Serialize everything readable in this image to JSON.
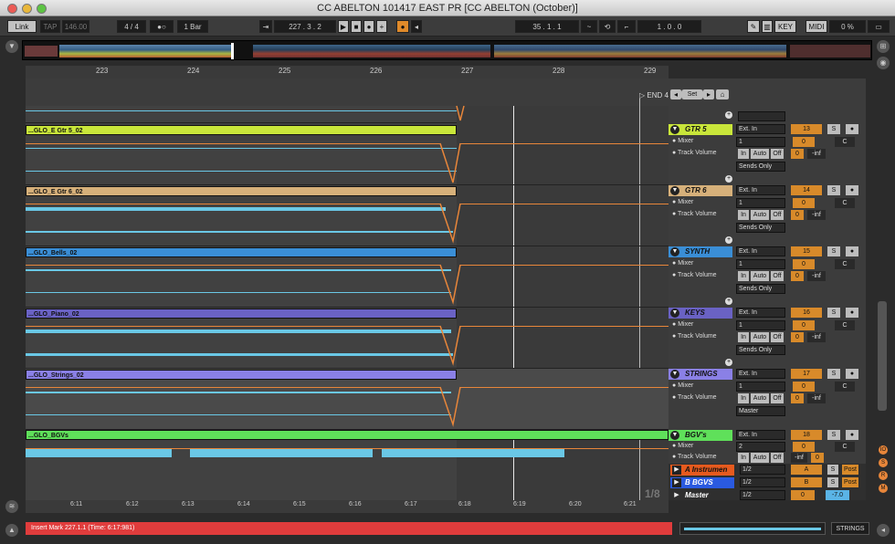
{
  "window": {
    "title": "CC ABELTON 101417 EAST PR  [CC ABELTON (October)]"
  },
  "toolbar": {
    "link": "Link",
    "tap": "TAP",
    "tempo": "146.00",
    "signature": "4 / 4",
    "quantize": "1 Bar",
    "position": "227 .  3 .  2",
    "loop_start": "35 .  1 .  1",
    "loop_length": "1 .  0 .  0",
    "key": "KEY",
    "midi": "MIDI",
    "cpu": "0 %"
  },
  "ruler": {
    "bars": [
      "223",
      "224",
      "225",
      "226",
      "227",
      "228",
      "229"
    ],
    "end_marker": "END 4"
  },
  "locators": {
    "set": "Set"
  },
  "tracks": [
    {
      "clip": "...GLO_E Gtr 5_02",
      "name": "GTR 5",
      "color": "#c9e63a",
      "input": "Ext. In",
      "monitor": "Mixer",
      "channel": "1",
      "param": "Track Volume",
      "number": "13",
      "sends": "Sends Only",
      "inf": "-inf",
      "c": "C",
      "s": "S"
    },
    {
      "clip": "...GLO_E Gtr 6_02",
      "name": "GTR 6",
      "color": "#d6b07a",
      "input": "Ext. In",
      "monitor": "Mixer",
      "channel": "1",
      "param": "Track Volume",
      "number": "14",
      "sends": "Sends Only",
      "inf": "-inf",
      "c": "C",
      "s": "S"
    },
    {
      "clip": "...GLO_Bells_02",
      "name": "SYNTH",
      "color": "#3a8ed6",
      "input": "Ext. In",
      "monitor": "Mixer",
      "channel": "1",
      "param": "Track Volume",
      "number": "15",
      "sends": "Sends Only",
      "inf": "-inf",
      "c": "C",
      "s": "S"
    },
    {
      "clip": "...GLO_Piano_02",
      "name": "KEYS",
      "color": "#6a62c4",
      "input": "Ext. In",
      "monitor": "Mixer",
      "channel": "1",
      "param": "Track Volume",
      "number": "16",
      "sends": "Sends Only",
      "inf": "-inf",
      "c": "C",
      "s": "S"
    },
    {
      "clip": "...GLO_Strings_02",
      "name": "STRINGS",
      "color": "#8a80e6",
      "input": "Ext. In",
      "monitor": "Mixer",
      "channel": "1",
      "param": "Track Volume",
      "number": "17",
      "sends": "Master",
      "inf": "-inf",
      "c": "C",
      "s": "S"
    },
    {
      "clip": "...GLO_BGVs",
      "name": "BGV's",
      "color": "#5fe05a",
      "input": "Ext. In",
      "monitor": "Mixer",
      "channel": "2",
      "param": "Track Volume",
      "number": "18",
      "sends": "",
      "inf": "-inf",
      "c": "C",
      "s": "S"
    }
  ],
  "modes": {
    "in": "In",
    "auto": "Auto",
    "off": "Off",
    "zero": "0"
  },
  "returns": [
    {
      "name": "A Instrumen",
      "color": "#e65a1e",
      "route": "1/2",
      "letter": "A",
      "post": "Post"
    },
    {
      "name": "B BGVS",
      "color": "#2a5ae0",
      "route": "1/2",
      "letter": "B",
      "post": "Post"
    },
    {
      "name": "Master",
      "color": "#3c3c3c",
      "route": "1/2",
      "letter": "0",
      "value": "-7.0"
    }
  ],
  "timeline": {
    "times": [
      "6:11",
      "6:12",
      "6:13",
      "6:14",
      "6:15",
      "6:16",
      "6:17",
      "6:18",
      "6:19",
      "6:20",
      "6:21"
    ],
    "fraction": "1/8"
  },
  "status": {
    "message": "Insert Mark 227.1.1 (Time: 6:17:981)"
  },
  "footer": {
    "track": "STRINGS"
  }
}
